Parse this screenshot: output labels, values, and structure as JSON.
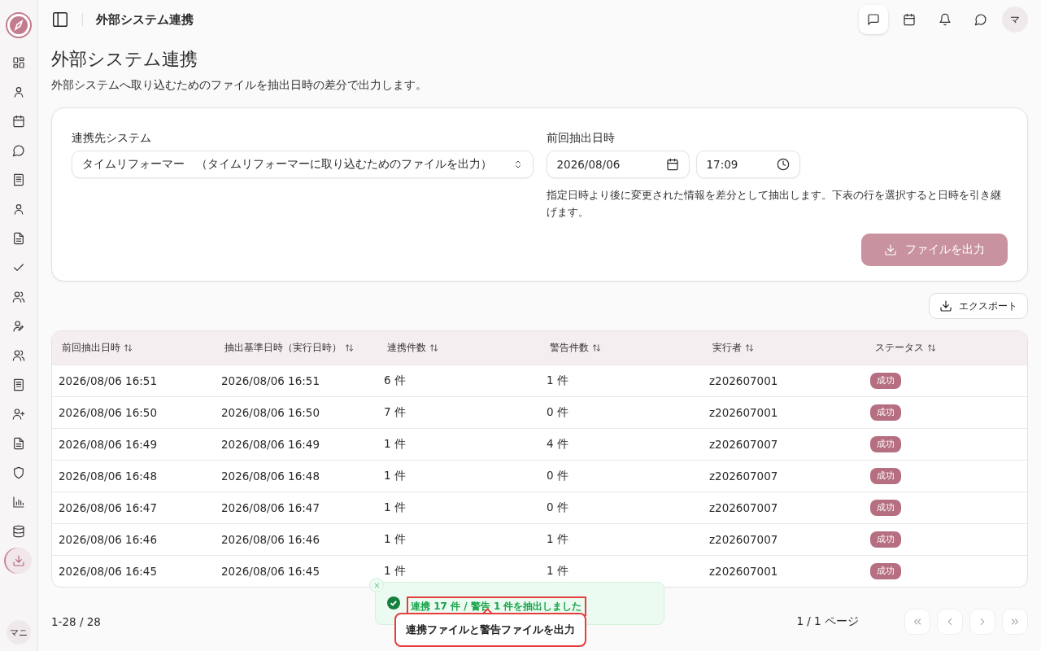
{
  "sidebar": {
    "items": [
      {
        "kind": "grid",
        "selected": false
      },
      {
        "kind": "user",
        "selected": false
      },
      {
        "kind": "calendar",
        "selected": false
      },
      {
        "kind": "chat",
        "selected": false
      },
      {
        "kind": "list",
        "selected": false
      },
      {
        "kind": "user",
        "selected": false
      },
      {
        "kind": "doc",
        "selected": false
      },
      {
        "kind": "check",
        "selected": false
      },
      {
        "kind": "users",
        "selected": false
      },
      {
        "kind": "user-edit",
        "selected": false
      },
      {
        "kind": "users",
        "selected": false
      },
      {
        "kind": "list",
        "selected": false
      },
      {
        "kind": "user-plus",
        "selected": false
      },
      {
        "kind": "doc",
        "selected": false
      },
      {
        "kind": "shield",
        "selected": false
      },
      {
        "kind": "chart",
        "selected": false
      },
      {
        "kind": "database",
        "selected": false
      },
      {
        "kind": "download",
        "selected": true
      }
    ],
    "user_avatar": "マニ"
  },
  "topbar": {
    "title": "外部システム連携",
    "actions": [
      {
        "kind": "message",
        "selected": true
      },
      {
        "kind": "calendar",
        "selected": false
      },
      {
        "kind": "bell",
        "selected": false
      },
      {
        "kind": "chat",
        "selected": false
      }
    ],
    "avatar": "マ"
  },
  "page": {
    "title": "外部システム連携",
    "subtitle": "外部システムへ取り込むためのファイルを抽出日時の差分で出力します。"
  },
  "form": {
    "system_label": "連携先システム",
    "system_value": "タイムリフォーマー　（タイムリフォーマーに取り込むためのファイルを出力）",
    "datetime_label": "前回抽出日時",
    "date_value": "2026/08/06",
    "time_value": "17:09",
    "help": "指定日時より後に変更された情報を差分として抽出します。下表の行を選択すると日時を引き継げます。",
    "submit": {
      "label": "ファイルを出力",
      "disabled": true
    }
  },
  "export_button": "エクスポート",
  "table": {
    "columns": [
      "前回抽出日時",
      "抽出基準日時（実行日時）",
      "連携件数",
      "警告件数",
      "実行者",
      "ステータス"
    ],
    "rows": [
      {
        "cells": [
          "2026/08/06 16:51",
          "2026/08/06 16:51",
          "6 件",
          "1 件",
          "z202607001"
        ],
        "status": "成功"
      },
      {
        "cells": [
          "2026/08/06 16:50",
          "2026/08/06 16:50",
          "7 件",
          "0 件",
          "z202607001"
        ],
        "status": "成功"
      },
      {
        "cells": [
          "2026/08/06 16:49",
          "2026/08/06 16:49",
          "1 件",
          "4 件",
          "z202607007"
        ],
        "status": "成功"
      },
      {
        "cells": [
          "2026/08/06 16:48",
          "2026/08/06 16:48",
          "1 件",
          "0 件",
          "z202607007"
        ],
        "status": "成功"
      },
      {
        "cells": [
          "2026/08/06 16:47",
          "2026/08/06 16:47",
          "1 件",
          "0 件",
          "z202607007"
        ],
        "status": "成功"
      },
      {
        "cells": [
          "2026/08/06 16:46",
          "2026/08/06 16:46",
          "1 件",
          "1 件",
          "z202607007"
        ],
        "status": "成功"
      },
      {
        "cells": [
          "2026/08/06 16:45",
          "2026/08/06 16:45",
          "1 件",
          "1 件",
          "z202607001"
        ],
        "status": "成功"
      }
    ]
  },
  "footer": {
    "range": "1-28 / 28",
    "page": "1 / 1 ページ"
  },
  "toast": {
    "message": "連携 17 件 / 警告 1 件を抽出しました",
    "tooltip": "連携ファイルと警告ファイルを出力"
  }
}
